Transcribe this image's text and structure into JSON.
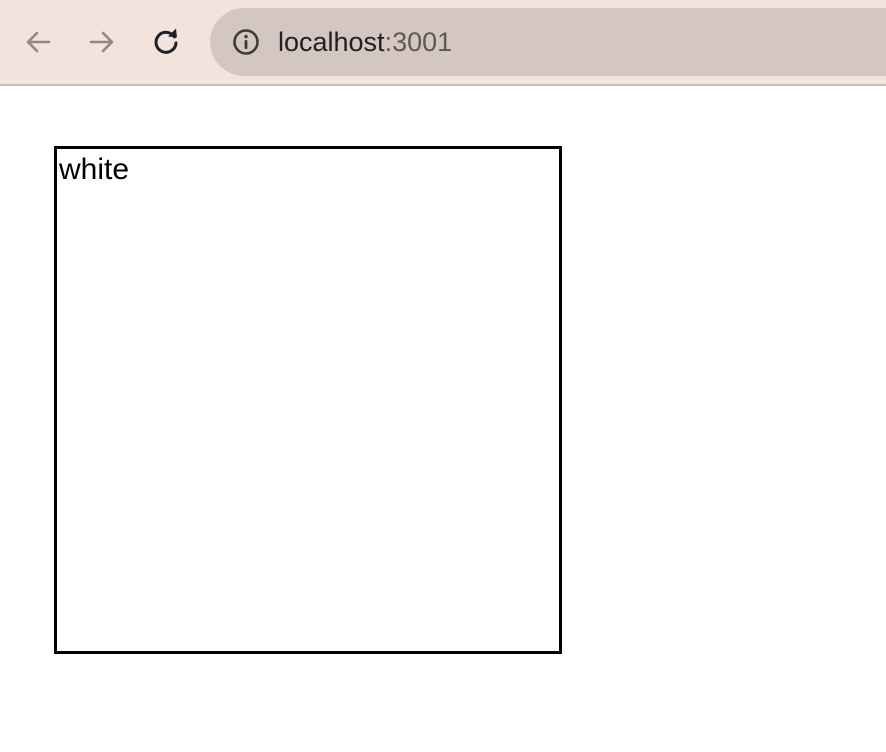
{
  "browser": {
    "url_host": "localhost",
    "url_port": ":3001",
    "icons": {
      "back": "arrow-left-icon",
      "forward": "arrow-right-icon",
      "reload": "reload-icon",
      "site_info": "info-icon"
    },
    "colors": {
      "toolbar_bg": "#f2e3dd",
      "omnibox_bg": "#d4c6c1"
    }
  },
  "page": {
    "box_label": "white",
    "box_border_color": "#000000"
  }
}
